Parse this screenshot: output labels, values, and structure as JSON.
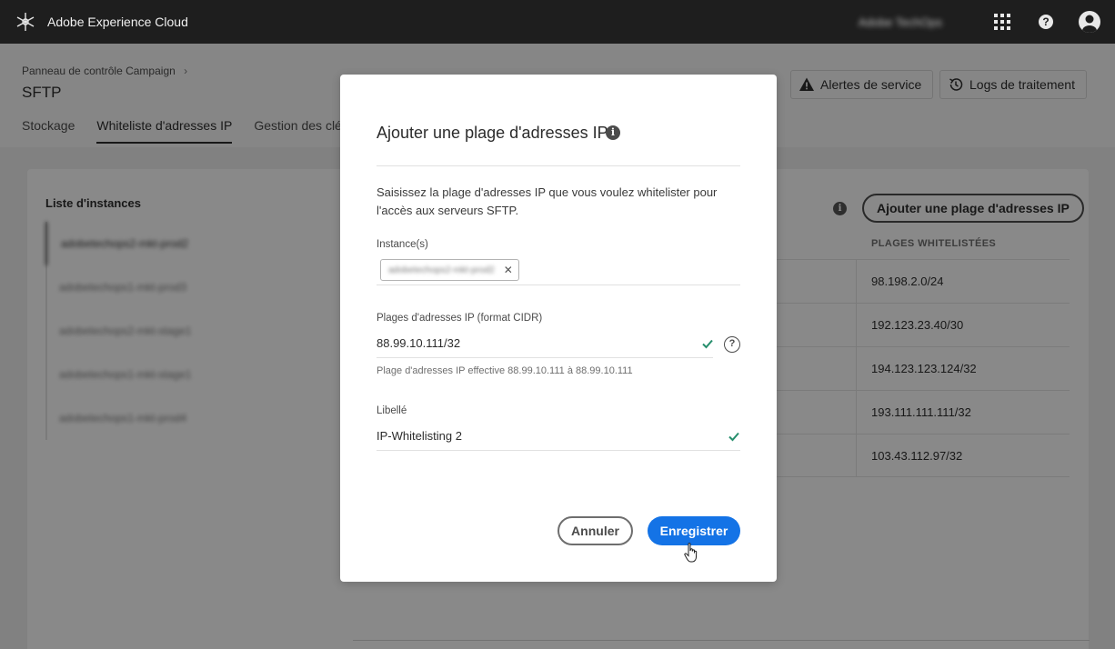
{
  "topbar": {
    "app_name": "Adobe Experience Cloud",
    "org_name": "Adobe TechOps",
    "icons": [
      "adobe-logo-icon",
      "apps-grid-icon",
      "help-icon",
      "user-avatar-icon"
    ]
  },
  "header": {
    "breadcrumb": "Panneau de contrôle Campaign",
    "breadcrumb_sep": "›",
    "title": "SFTP",
    "tabs": [
      {
        "label": "Stockage",
        "active": false
      },
      {
        "label": "Whiteliste d'adresses IP",
        "active": true
      },
      {
        "label": "Gestion des clés",
        "active": false
      }
    ],
    "service_alerts_label": "Alertes de service",
    "processing_logs_label": "Logs de traitement"
  },
  "panel": {
    "instances_title": "Liste d'instances",
    "instances": [
      "adobetechops2-mkt-prod2",
      "adobetechops1-mkt-prod3",
      "adobetechops2-mkt-stage1",
      "adobetechops1-mkt-stage1",
      "adobetechops1-mkt-prod4"
    ],
    "add_button_label": "Ajouter une plage d'adresses IP",
    "column_header": "PLAGES WHITELISTÉES",
    "ranges": [
      "98.198.2.0/24",
      "192.123.23.40/30",
      "194.123.123.124/32",
      "193.111.111.111/32",
      "103.43.112.97/32"
    ]
  },
  "modal": {
    "title": "Ajouter une plage d'adresses IP",
    "description": "Saisissez la plage d'adresses IP que vous voulez whitelister pour l'accès aux serveurs SFTP.",
    "instances_label": "Instance(s)",
    "instance_tag": "adobetechops2-mkt-prod2",
    "tag_remove": "✕",
    "ip_label": "Plages d'adresses IP (format CIDR)",
    "ip_value": "88.99.10.111/32",
    "ip_help": "Plage d'adresses IP effective 88.99.10.111 à 88.99.10.111",
    "help_mark": "?",
    "label_label": "Libellé",
    "label_value": "IP-Whitelisting 2",
    "cancel_label": "Annuler",
    "save_label": "Enregistrer",
    "info_mark": "i"
  },
  "colors": {
    "topbar_bg": "#1e1e1e",
    "accent_blue": "#1473e6",
    "valid_green": "#268e6c"
  }
}
